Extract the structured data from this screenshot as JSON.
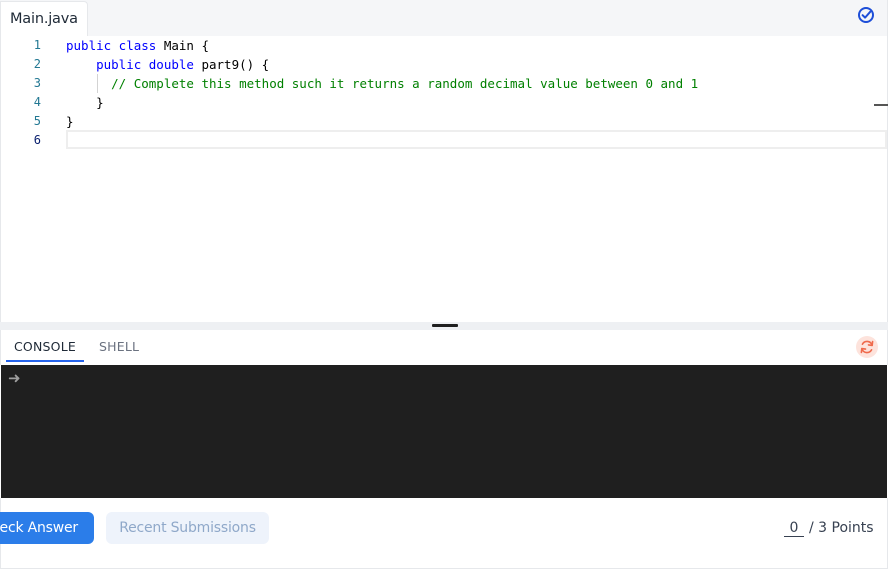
{
  "editor": {
    "file_tab": "Main.java",
    "lines": [
      {
        "num": "1",
        "parts": [
          {
            "t": "public class",
            "c": "kw"
          },
          {
            "t": " Main {",
            "c": ""
          }
        ]
      },
      {
        "num": "2",
        "parts": [
          {
            "t": "    public double",
            "c": "kw"
          },
          {
            "t": " part9() {",
            "c": ""
          }
        ]
      },
      {
        "num": "3",
        "parts": [
          {
            "t": "      // Complete this method such it returns a random decimal value between 0 and 1",
            "c": "cm"
          }
        ]
      },
      {
        "num": "4",
        "parts": [
          {
            "t": "    }",
            "c": ""
          }
        ]
      },
      {
        "num": "5",
        "parts": [
          {
            "t": "}",
            "c": ""
          }
        ]
      },
      {
        "num": "6",
        "parts": []
      }
    ],
    "active_line": "6"
  },
  "console": {
    "tabs": {
      "console": "CONSOLE",
      "shell": "SHELL"
    },
    "active_tab": "CONSOLE",
    "prompt_symbol": "➜"
  },
  "footer": {
    "check_answer": "Check Answer",
    "recent_submissions": "Recent Submissions",
    "score": "0",
    "points_total": "/ 3 Points"
  },
  "colors": {
    "primary": "#2b7de9",
    "keyword": "#0000ff",
    "comment": "#008000",
    "terminal_bg": "#1f1f1f",
    "line_number": "#237893"
  },
  "icons": {
    "status": "check-circle-icon",
    "reset": "refresh-icon",
    "prompt": "arrow-right-icon"
  }
}
